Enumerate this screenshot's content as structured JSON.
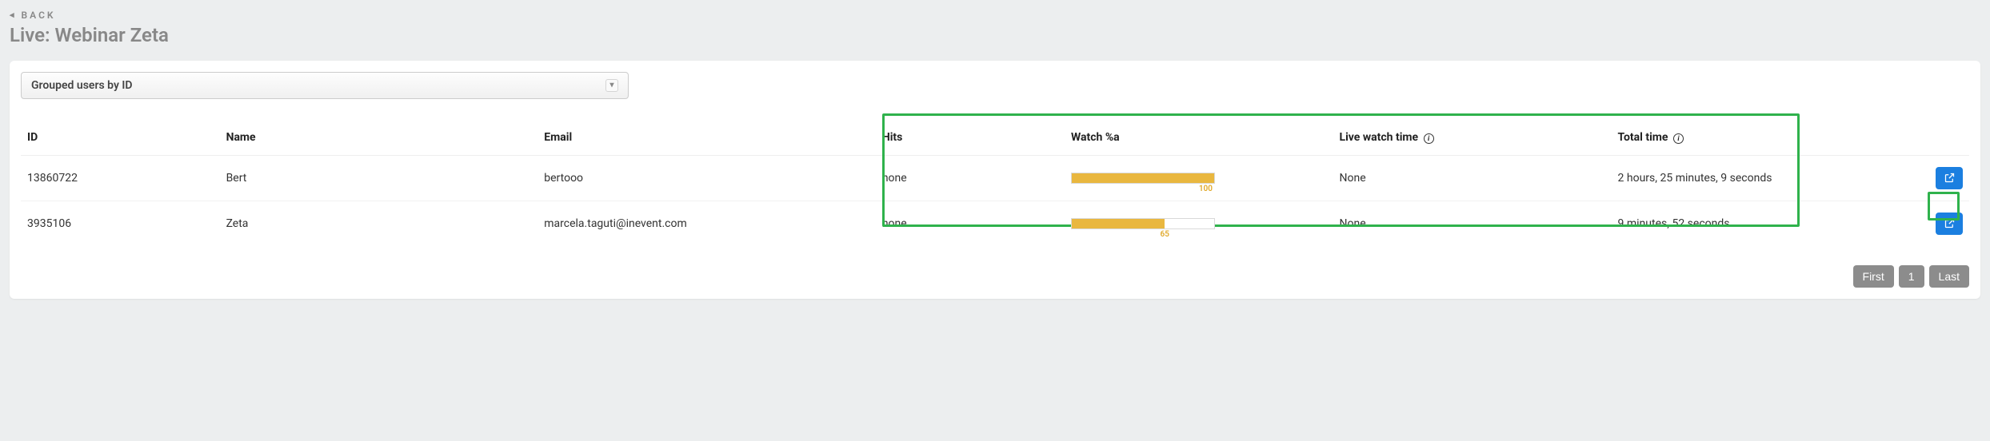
{
  "back_label": "BACK",
  "page_title": "Live: Webinar Zeta",
  "dropdown": {
    "selected": "Grouped users by ID"
  },
  "columns": {
    "id": "ID",
    "name": "Name",
    "email": "Email",
    "hits": "Hits",
    "watch": "Watch %a",
    "live": "Live watch time",
    "total": "Total time"
  },
  "rows": [
    {
      "id": "13860722",
      "name": "Bert",
      "email": "bertooo",
      "hits": "none",
      "watch_pct": 100,
      "watch_pct_label": "100",
      "live": "None",
      "total": "2 hours, 25 minutes, 9 seconds"
    },
    {
      "id": "3935106",
      "name": "Zeta",
      "email": "marcela.taguti@inevent.com",
      "hits": "none",
      "watch_pct": 65,
      "watch_pct_label": "65",
      "live": "None",
      "total": "9 minutes, 52 seconds"
    }
  ],
  "pager": {
    "first": "First",
    "page": "1",
    "last": "Last"
  }
}
